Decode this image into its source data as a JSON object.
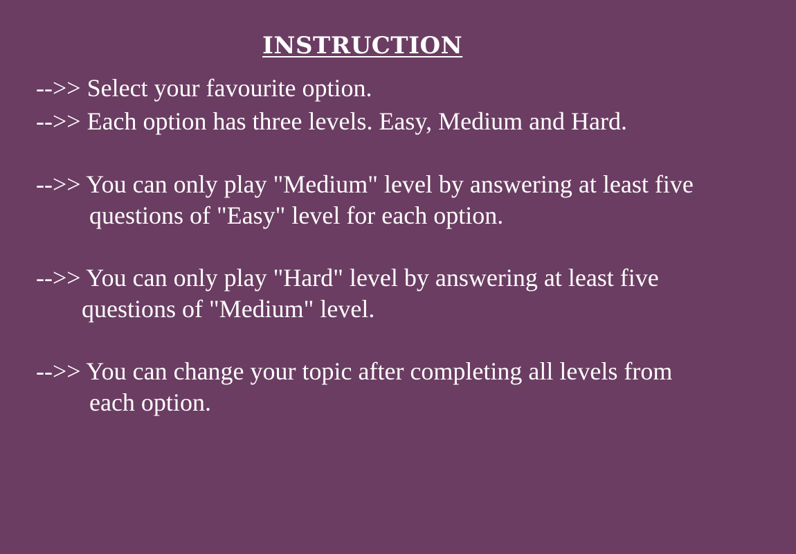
{
  "colors": {
    "background": "#6b3d62",
    "text": "#ffffff"
  },
  "instruction": {
    "title": "INSTRUCTION",
    "items": [
      {
        "lines": [
          "-->> Select your favourite option."
        ]
      },
      {
        "lines": [
          "-->> Each option has three levels. Easy, Medium and Hard."
        ]
      },
      {
        "lines": [
          "-->> You can only play \"Medium\" level by answering at least five",
          "questions of \"Easy\" level for each option."
        ]
      },
      {
        "lines": [
          "-->> You can only play \"Hard\" level by answering at least five",
          "questions of \"Medium\" level."
        ]
      },
      {
        "lines": [
          "-->> You can change your topic after completing all levels from",
          "each option."
        ]
      }
    ]
  }
}
